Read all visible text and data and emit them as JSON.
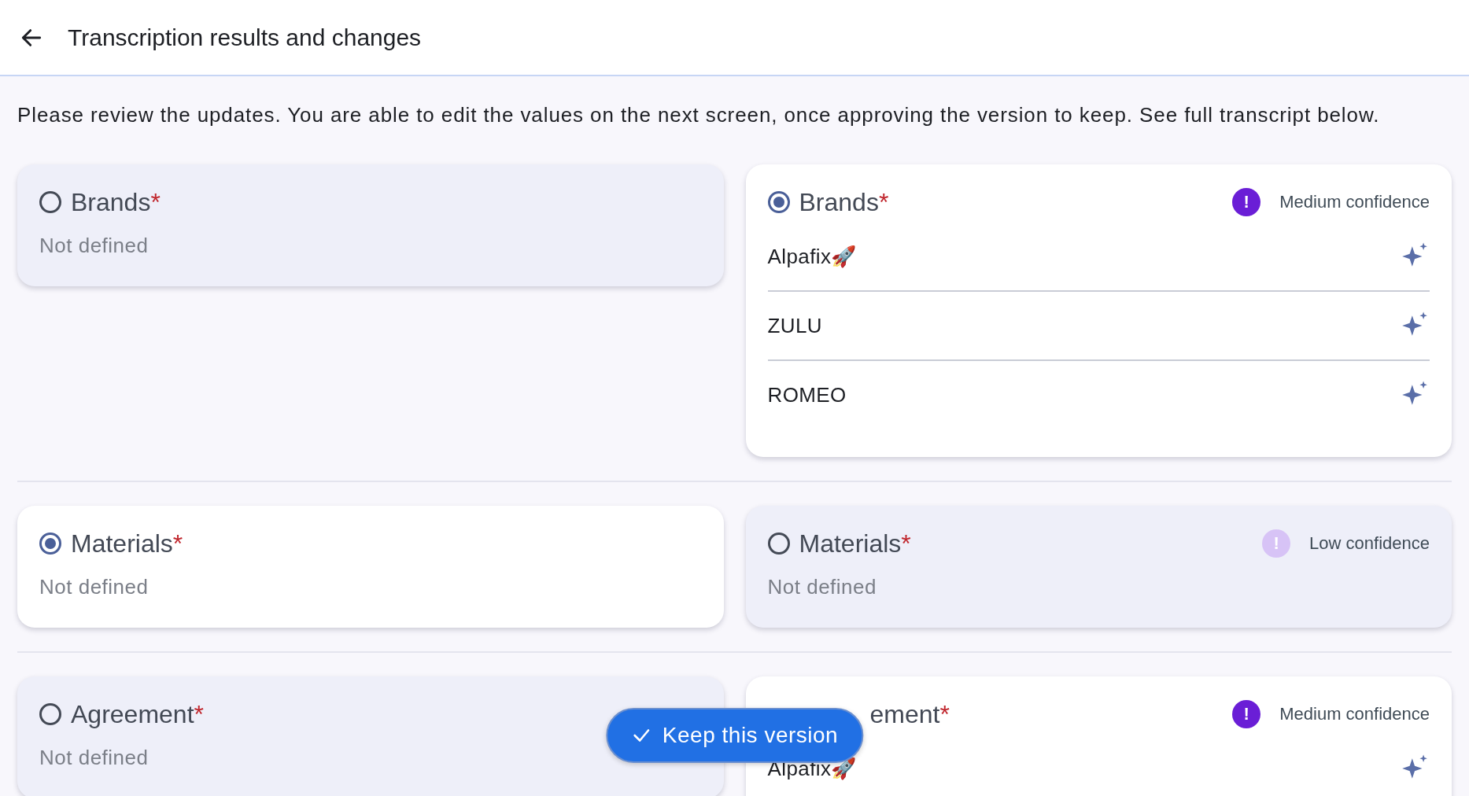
{
  "header": {
    "title": "Transcription results and changes"
  },
  "intro": "Please review the updates. You are able to edit the values on the next screen, once approving the version to keep. See full transcript below.",
  "rows": [
    {
      "options": [
        {
          "title": "Brands",
          "required_mark": "*",
          "selected": false,
          "empty_text": "Not defined"
        },
        {
          "title": "Brands",
          "required_mark": "*",
          "selected": true,
          "confidence": {
            "kind": "medium",
            "icon": "!",
            "label": "Medium confidence"
          },
          "values": [
            {
              "text": "Alpafix🚀"
            },
            {
              "text": "ZULU"
            },
            {
              "text": "ROMEO"
            }
          ]
        }
      ]
    },
    {
      "options": [
        {
          "title": "Materials",
          "required_mark": "*",
          "selected": true,
          "empty_text": "Not defined"
        },
        {
          "title": "Materials",
          "required_mark": "*",
          "selected": false,
          "confidence": {
            "kind": "low",
            "icon": "!",
            "label": "Low confidence"
          },
          "empty_text": "Not defined"
        }
      ]
    },
    {
      "options": [
        {
          "title": "Agreement",
          "required_mark": "*",
          "selected": false,
          "empty_text": "Not defined"
        },
        {
          "title": "ement",
          "required_mark": "*",
          "selected": true,
          "covered": true,
          "confidence": {
            "kind": "medium",
            "icon": "!",
            "label": "Medium confidence"
          },
          "values": [
            {
              "text": "Alpafix🚀"
            }
          ]
        }
      ]
    }
  ],
  "keep_button": {
    "label": "Keep this version"
  }
}
